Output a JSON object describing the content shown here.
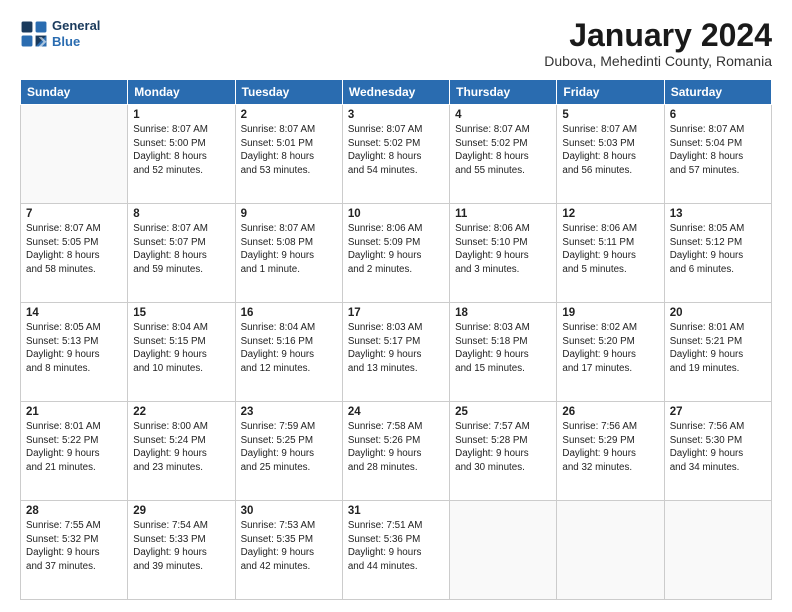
{
  "header": {
    "logo_line1": "General",
    "logo_line2": "Blue",
    "month": "January 2024",
    "location": "Dubova, Mehedinti County, Romania"
  },
  "days_of_week": [
    "Sunday",
    "Monday",
    "Tuesday",
    "Wednesday",
    "Thursday",
    "Friday",
    "Saturday"
  ],
  "weeks": [
    [
      {
        "num": "",
        "info": ""
      },
      {
        "num": "1",
        "info": "Sunrise: 8:07 AM\nSunset: 5:00 PM\nDaylight: 8 hours\nand 52 minutes."
      },
      {
        "num": "2",
        "info": "Sunrise: 8:07 AM\nSunset: 5:01 PM\nDaylight: 8 hours\nand 53 minutes."
      },
      {
        "num": "3",
        "info": "Sunrise: 8:07 AM\nSunset: 5:02 PM\nDaylight: 8 hours\nand 54 minutes."
      },
      {
        "num": "4",
        "info": "Sunrise: 8:07 AM\nSunset: 5:02 PM\nDaylight: 8 hours\nand 55 minutes."
      },
      {
        "num": "5",
        "info": "Sunrise: 8:07 AM\nSunset: 5:03 PM\nDaylight: 8 hours\nand 56 minutes."
      },
      {
        "num": "6",
        "info": "Sunrise: 8:07 AM\nSunset: 5:04 PM\nDaylight: 8 hours\nand 57 minutes."
      }
    ],
    [
      {
        "num": "7",
        "info": "Sunrise: 8:07 AM\nSunset: 5:05 PM\nDaylight: 8 hours\nand 58 minutes."
      },
      {
        "num": "8",
        "info": "Sunrise: 8:07 AM\nSunset: 5:07 PM\nDaylight: 8 hours\nand 59 minutes."
      },
      {
        "num": "9",
        "info": "Sunrise: 8:07 AM\nSunset: 5:08 PM\nDaylight: 9 hours\nand 1 minute."
      },
      {
        "num": "10",
        "info": "Sunrise: 8:06 AM\nSunset: 5:09 PM\nDaylight: 9 hours\nand 2 minutes."
      },
      {
        "num": "11",
        "info": "Sunrise: 8:06 AM\nSunset: 5:10 PM\nDaylight: 9 hours\nand 3 minutes."
      },
      {
        "num": "12",
        "info": "Sunrise: 8:06 AM\nSunset: 5:11 PM\nDaylight: 9 hours\nand 5 minutes."
      },
      {
        "num": "13",
        "info": "Sunrise: 8:05 AM\nSunset: 5:12 PM\nDaylight: 9 hours\nand 6 minutes."
      }
    ],
    [
      {
        "num": "14",
        "info": "Sunrise: 8:05 AM\nSunset: 5:13 PM\nDaylight: 9 hours\nand 8 minutes."
      },
      {
        "num": "15",
        "info": "Sunrise: 8:04 AM\nSunset: 5:15 PM\nDaylight: 9 hours\nand 10 minutes."
      },
      {
        "num": "16",
        "info": "Sunrise: 8:04 AM\nSunset: 5:16 PM\nDaylight: 9 hours\nand 12 minutes."
      },
      {
        "num": "17",
        "info": "Sunrise: 8:03 AM\nSunset: 5:17 PM\nDaylight: 9 hours\nand 13 minutes."
      },
      {
        "num": "18",
        "info": "Sunrise: 8:03 AM\nSunset: 5:18 PM\nDaylight: 9 hours\nand 15 minutes."
      },
      {
        "num": "19",
        "info": "Sunrise: 8:02 AM\nSunset: 5:20 PM\nDaylight: 9 hours\nand 17 minutes."
      },
      {
        "num": "20",
        "info": "Sunrise: 8:01 AM\nSunset: 5:21 PM\nDaylight: 9 hours\nand 19 minutes."
      }
    ],
    [
      {
        "num": "21",
        "info": "Sunrise: 8:01 AM\nSunset: 5:22 PM\nDaylight: 9 hours\nand 21 minutes."
      },
      {
        "num": "22",
        "info": "Sunrise: 8:00 AM\nSunset: 5:24 PM\nDaylight: 9 hours\nand 23 minutes."
      },
      {
        "num": "23",
        "info": "Sunrise: 7:59 AM\nSunset: 5:25 PM\nDaylight: 9 hours\nand 25 minutes."
      },
      {
        "num": "24",
        "info": "Sunrise: 7:58 AM\nSunset: 5:26 PM\nDaylight: 9 hours\nand 28 minutes."
      },
      {
        "num": "25",
        "info": "Sunrise: 7:57 AM\nSunset: 5:28 PM\nDaylight: 9 hours\nand 30 minutes."
      },
      {
        "num": "26",
        "info": "Sunrise: 7:56 AM\nSunset: 5:29 PM\nDaylight: 9 hours\nand 32 minutes."
      },
      {
        "num": "27",
        "info": "Sunrise: 7:56 AM\nSunset: 5:30 PM\nDaylight: 9 hours\nand 34 minutes."
      }
    ],
    [
      {
        "num": "28",
        "info": "Sunrise: 7:55 AM\nSunset: 5:32 PM\nDaylight: 9 hours\nand 37 minutes."
      },
      {
        "num": "29",
        "info": "Sunrise: 7:54 AM\nSunset: 5:33 PM\nDaylight: 9 hours\nand 39 minutes."
      },
      {
        "num": "30",
        "info": "Sunrise: 7:53 AM\nSunset: 5:35 PM\nDaylight: 9 hours\nand 42 minutes."
      },
      {
        "num": "31",
        "info": "Sunrise: 7:51 AM\nSunset: 5:36 PM\nDaylight: 9 hours\nand 44 minutes."
      },
      {
        "num": "",
        "info": ""
      },
      {
        "num": "",
        "info": ""
      },
      {
        "num": "",
        "info": ""
      }
    ]
  ]
}
